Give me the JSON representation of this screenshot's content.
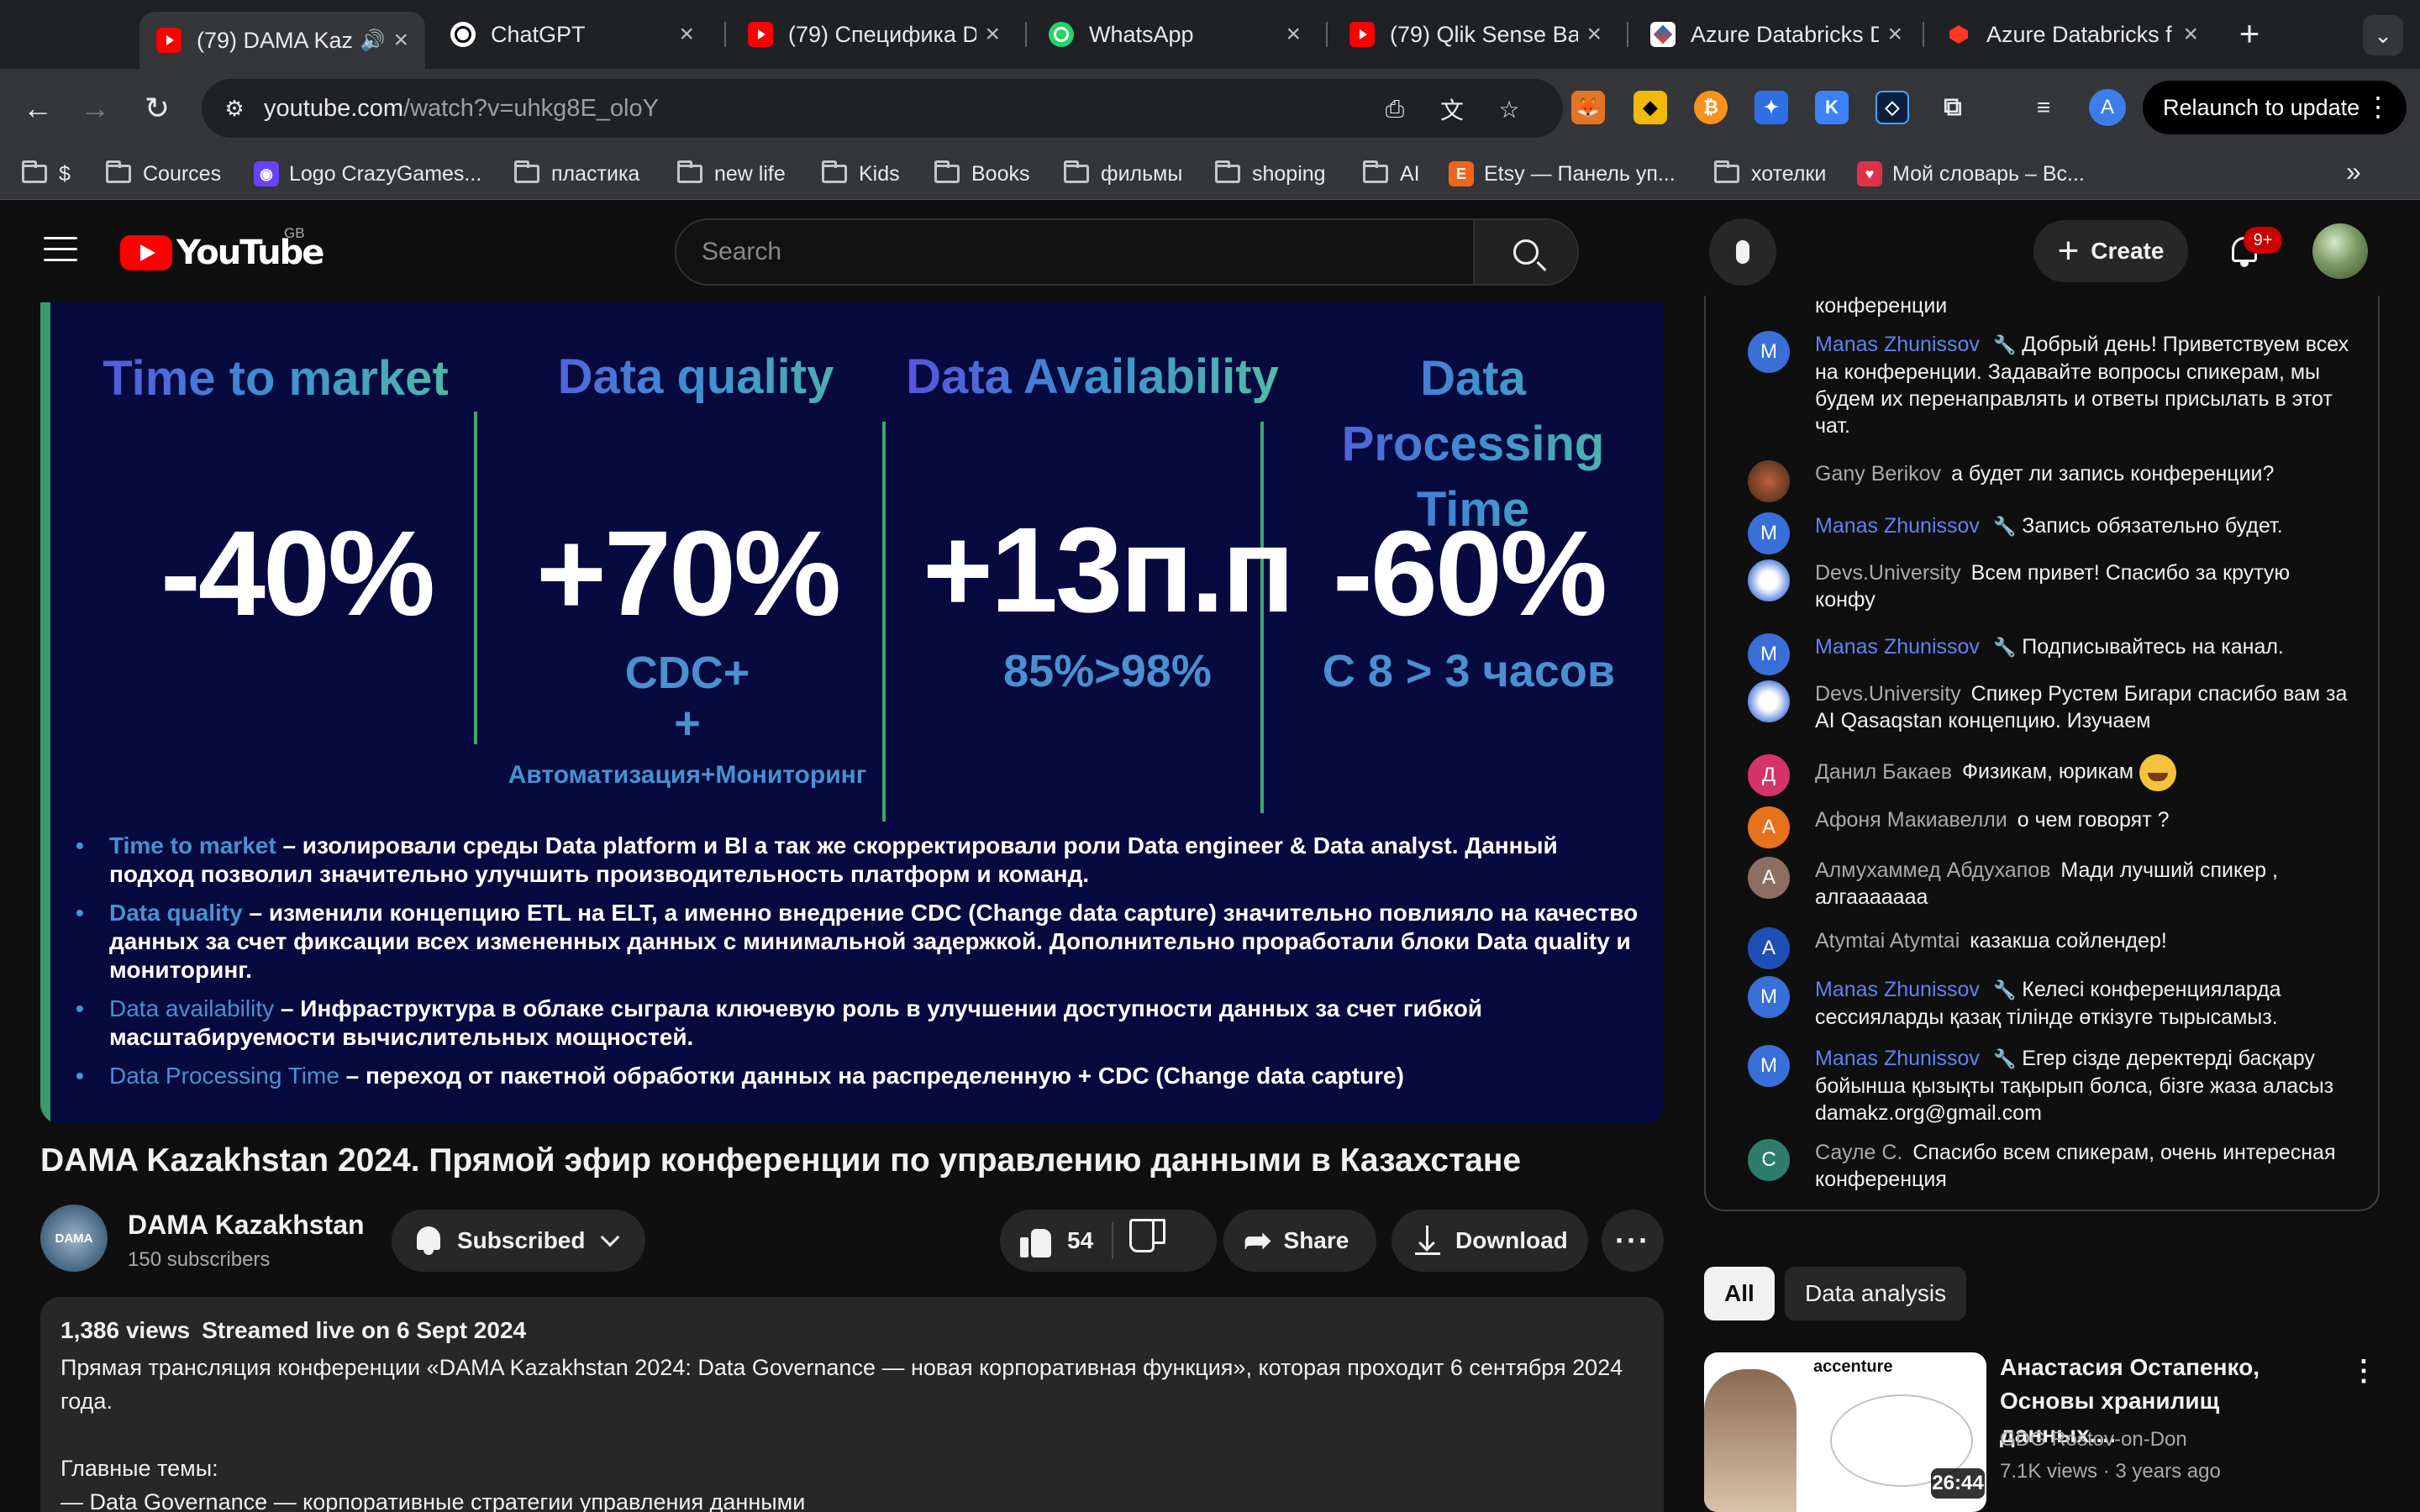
{
  "browser": {
    "tabs": [
      {
        "title": "(79) DAMA Kaz",
        "icon": "youtube-icon",
        "active": true
      },
      {
        "title": "ChatGPT",
        "icon": "chatgpt-icon"
      },
      {
        "title": "(79) Специфика D",
        "icon": "youtube-icon"
      },
      {
        "title": "WhatsApp",
        "icon": "whatsapp-icon"
      },
      {
        "title": "(79) Qlik Sense Ba",
        "icon": "youtube-icon"
      },
      {
        "title": "Azure Databricks D",
        "icon": "azure-icon"
      },
      {
        "title": "Azure Databricks f",
        "icon": "databricks-icon"
      }
    ],
    "url_host": "youtube.com",
    "url_path": "/watch?v=uhkg8E_oloY",
    "relaunch_label": "Relaunch to update",
    "profile_initial": "A",
    "bookmarks": [
      {
        "label": "$",
        "type": "folder"
      },
      {
        "label": "Cources",
        "type": "folder"
      },
      {
        "label": "Logo CrazyGames...",
        "type": "site"
      },
      {
        "label": "пластика",
        "type": "folder"
      },
      {
        "label": "new life",
        "type": "folder"
      },
      {
        "label": "Kids",
        "type": "folder"
      },
      {
        "label": "Books",
        "type": "folder"
      },
      {
        "label": "фильмы",
        "type": "folder"
      },
      {
        "label": "shoping",
        "type": "folder"
      },
      {
        "label": "AI",
        "type": "folder"
      },
      {
        "label": "Etsy — Панель уп...",
        "type": "site"
      },
      {
        "label": "хотелки",
        "type": "folder"
      },
      {
        "label": "Мой словарь – Вс...",
        "type": "site"
      }
    ]
  },
  "youtube": {
    "logo_text": "YouTube",
    "region": "GB",
    "search_placeholder": "Search",
    "create_label": "Create",
    "notif_badge": "9+"
  },
  "slide": {
    "columns": [
      {
        "heading": "Time to market",
        "value": "-40%",
        "sub": "",
        "sub2": "",
        "sub3": ""
      },
      {
        "heading": "Data quality",
        "value": "+70%",
        "sub": "CDC+",
        "sub2": "+",
        "sub3": "Автоматизация+Мониторинг"
      },
      {
        "heading": "Data Availability",
        "value": "+13п.п",
        "sub": "85%>98%",
        "sub2": "",
        "sub3": ""
      },
      {
        "heading": "Data Processing Time",
        "value": "-60%",
        "sub": "С 8 > 3 часов",
        "sub2": "",
        "sub3": ""
      }
    ],
    "bullets": [
      {
        "key": "Time to market",
        "text": " – изолировали среды Data platform и BI а так же скорректировали роли Data engineer & Data analyst. Данный подход позволил значительно улучшить производительность платформ и команд."
      },
      {
        "key": "Data quality",
        "text": " – изменили концепцию ETL на ELT, а именно внедрение CDC (Change data capture) значительно повлияло на качество данных за счет фиксации всех измененных данных с минимальной  задержкой. Дополнительно проработали блоки Data quality и мониторинг."
      },
      {
        "key": "Data availability",
        "text": " – Инфраструктура в облаке сыграла ключевую роль в улучшении доступности данных за счет гибкой масштабируемости вычислительных мощностей."
      },
      {
        "key": "Data Processing Time",
        "text": " – переход от пакетной обработки данных на распределенную + CDC (Change data capture)"
      }
    ]
  },
  "video": {
    "title": "DAMA Kazakhstan 2024. Прямой эфир конференции по управлению данными в Казахстане",
    "channel_name": "DAMA Kazakhstan",
    "channel_avatar_text": "DAMA",
    "subscribers": "150 subscribers",
    "subscribed_label": "Subscribed",
    "likes": "54",
    "share_label": "Share",
    "download_label": "Download",
    "views": "1,386 views",
    "streamed": "Streamed live on 6 Sept 2024",
    "description": "Прямая трансляция конференции «DAMA Kazakhstan 2024: Data Governance — новая корпоративная функция», которая проходит 6 сентября 2024 года.\n\nГлавные темы:\n— Data Governance — корпоративные стратегии управления данными"
  },
  "chat": {
    "messages": [
      {
        "author": "",
        "text": "конференции",
        "mod": false,
        "avatar": ""
      },
      {
        "author": "Manas Zhunissov",
        "text": "Добрый день! Приветствуем всех на конференции. Задавайте вопросы спикерам, мы будем их перенаправлять и ответы присылать в этот чат.",
        "mod": true,
        "avatar": "M"
      },
      {
        "author": "Gany Berikov",
        "text": "а будет ли запись конференции?",
        "mod": false,
        "avatar": ""
      },
      {
        "author": "Manas Zhunissov",
        "text": "Запись обязательно будет.",
        "mod": true,
        "avatar": "M"
      },
      {
        "author": "Devs.University",
        "text": "Всем привет! Спасибо за крутую конфу",
        "mod": false,
        "avatar": ""
      },
      {
        "author": "Manas Zhunissov",
        "text": "Подписывайтесь на канал.",
        "mod": true,
        "avatar": "M"
      },
      {
        "author": "Devs.University",
        "text": "Спикер Рустем Бигари спасибо вам за AI Qasaqstan концепцию. Изучаем",
        "mod": false,
        "avatar": ""
      },
      {
        "author": "Данил Бакаев",
        "text": "Физикам, юрикам",
        "mod": false,
        "avatar": "Д"
      },
      {
        "author": "Афоня Макиавелли",
        "text": "о чем говорят ?",
        "mod": false,
        "avatar": "А"
      },
      {
        "author": "Алмухаммед Абдухапов",
        "text": "Мади лучший спикер , алгааааааа",
        "mod": false,
        "avatar": "А"
      },
      {
        "author": "Atymtai Atymtai",
        "text": "казакша сойлендер!",
        "mod": false,
        "avatar": "A"
      },
      {
        "author": "Manas Zhunissov",
        "text": "Келесі конференцияларда сессияларды қазақ тілінде өткізуге тырысамыз.",
        "mod": true,
        "avatar": "M"
      },
      {
        "author": "Manas Zhunissov",
        "text": "Егер сізде деректерді басқару бойынша қызықты тақырып болса, бізге жаза аласыз damakz.org@gmail.com",
        "mod": true,
        "avatar": "M"
      },
      {
        "author": "Сауле С.",
        "text": "Спасибо всем спикерам, очень интересная конференция",
        "mod": false,
        "avatar": "С"
      }
    ]
  },
  "recommendations": {
    "chips": [
      "All",
      "Data analysis"
    ],
    "items": [
      {
        "title": "Анастасия Остапенко, Основы хранилищ данных....",
        "channel": "GDG Rostov-on-Don",
        "views": "7.1K views",
        "age": "3 years ago",
        "duration": "26:44",
        "thumb_logo": "accenture"
      }
    ]
  },
  "colors": {
    "slide_bg": "#060a3f",
    "accent_blue": "#4a90d0",
    "separator_green": "#3ca86a",
    "mod_blue": "#5e84f1",
    "yt_red": "#ff0000"
  }
}
